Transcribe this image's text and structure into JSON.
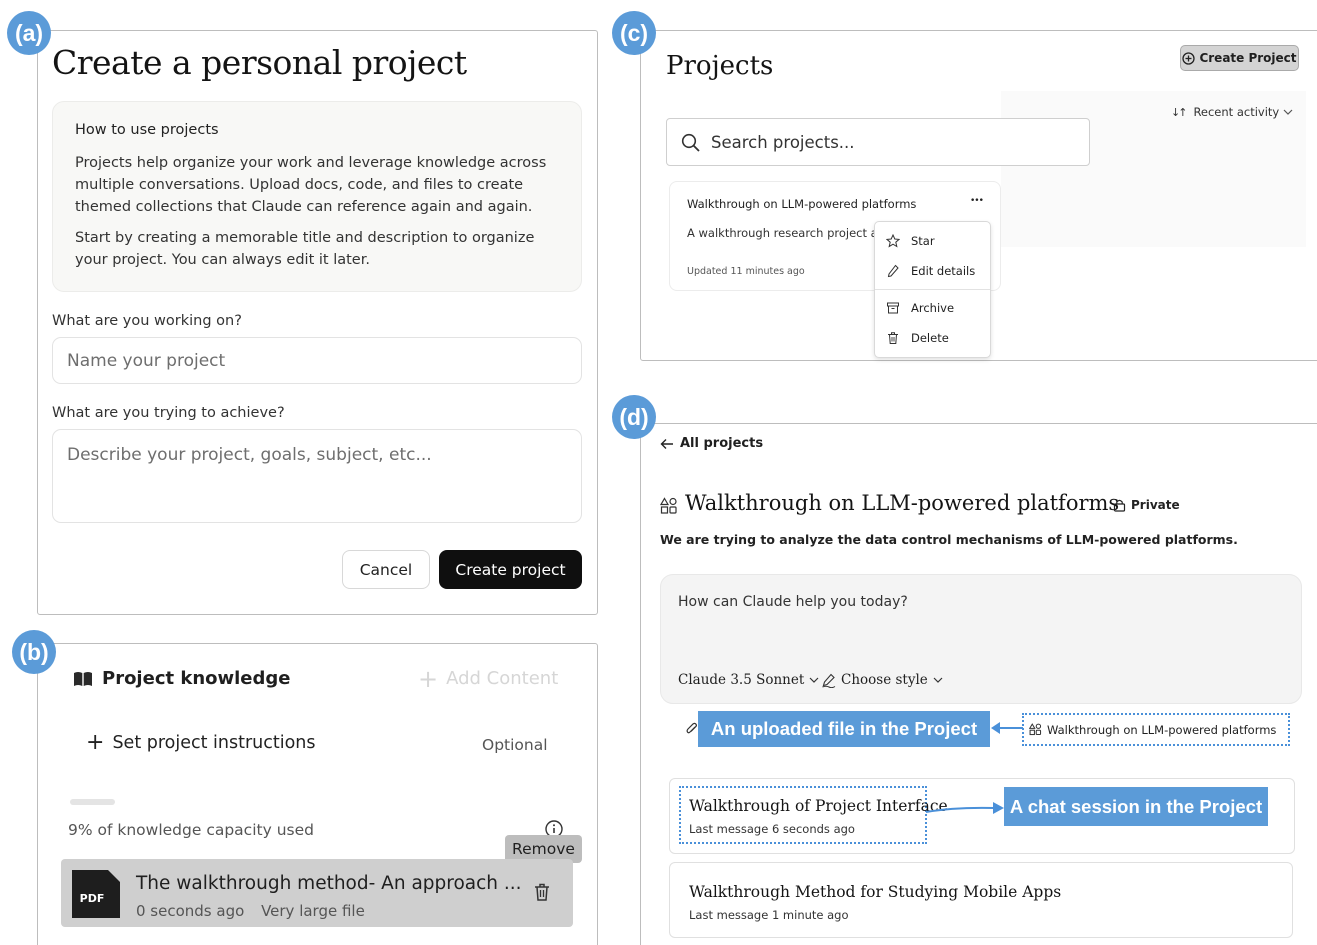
{
  "badges": {
    "a": "(a)",
    "b": "(b)",
    "c": "(c)",
    "d": "(d)"
  },
  "panel_a": {
    "title": "Create a personal project",
    "info_heading": "How to use projects",
    "info_p1_lines": [
      "Projects help organize your work and leverage knowledge across",
      "multiple conversations. Upload docs, code, and files to create",
      "themed collections that Claude can reference again and again."
    ],
    "info_p2_lines": [
      "Start by creating a memorable title and description to organize",
      "your project. You can always edit it later."
    ],
    "name_label": "What are you working on?",
    "name_placeholder": "Name your project",
    "desc_label": "What are you trying to achieve?",
    "desc_placeholder": "Describe your project, goals, subject, etc...",
    "cancel_label": "Cancel",
    "create_label": "Create project"
  },
  "panel_b": {
    "title": "Project knowledge",
    "add_content": "Add Content",
    "instructions_label": "Set project instructions",
    "optional_label": "Optional",
    "capacity_text": "9% of knowledge capacity used",
    "capacity_fraction": 0.09,
    "remove_tooltip": "Remove",
    "file": {
      "type_label": "PDF",
      "name": "The walkthrough method- An approach ...",
      "time": "0 seconds ago",
      "size_note": "Very large file"
    }
  },
  "panel_c": {
    "title": "Projects",
    "create_label": "Create Project",
    "sort_label": "Recent activity",
    "search_placeholder": "Search projects...",
    "card": {
      "title": "Walkthrough on LLM-powered platforms",
      "description": "A walkthrough research project ab",
      "updated": "Updated 11 minutes ago",
      "more": "•••"
    },
    "menu": [
      "Star",
      "Edit details",
      "Archive",
      "Delete"
    ]
  },
  "panel_d": {
    "back_label": "All projects",
    "project_title": "Walkthrough on LLM-powered platforms",
    "private_label": "Private",
    "description": "We are trying to analyze the data control mechanisms of LLM-powered platforms.",
    "prompt_placeholder": "How can Claude help you today?",
    "model_label": "Claude 3.5 Sonnet",
    "style_label": "Choose style",
    "uploaded_annotation": "An uploaded file in the Project",
    "file_chip": "Walkthrough on LLM-powered platforms",
    "chat_annotation": "A chat session in the Project",
    "chats": [
      {
        "title": "Walkthrough of Project Interface",
        "meta": "Last message 6 seconds ago"
      },
      {
        "title": "Walkthrough Method for Studying Mobile Apps",
        "meta": "Last message 1 minute ago"
      }
    ]
  },
  "colors": {
    "badge": "#5b9bd8",
    "annotation": "#5b9bd8",
    "annotation_border": "#4a90d9"
  }
}
